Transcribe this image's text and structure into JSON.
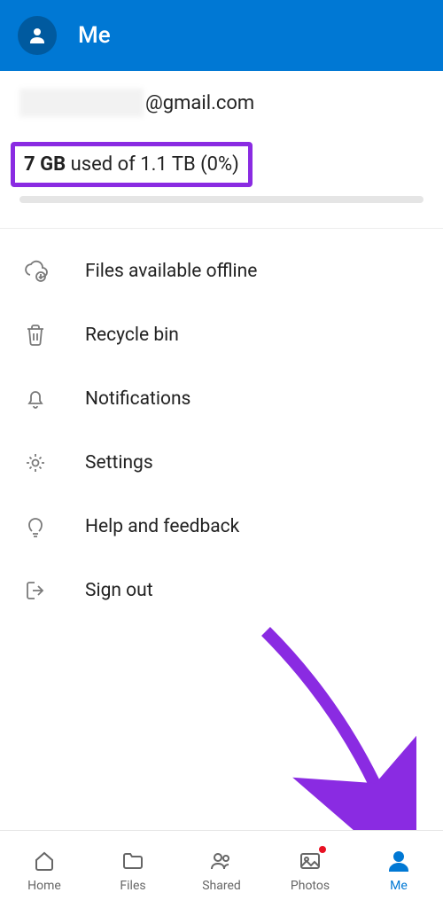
{
  "header": {
    "title": "Me"
  },
  "account": {
    "email_domain": "@gmail.com",
    "storage_used": "7 GB",
    "storage_text": " used of 1.1 TB (0%)"
  },
  "menu": {
    "offline": "Files available offline",
    "recycle": "Recycle bin",
    "notifications": "Notifications",
    "settings": "Settings",
    "help": "Help and feedback",
    "signout": "Sign out"
  },
  "nav": {
    "home": "Home",
    "files": "Files",
    "shared": "Shared",
    "photos": "Photos",
    "me": "Me"
  },
  "colors": {
    "brand": "#0078d4",
    "highlight": "#8a2be2"
  }
}
